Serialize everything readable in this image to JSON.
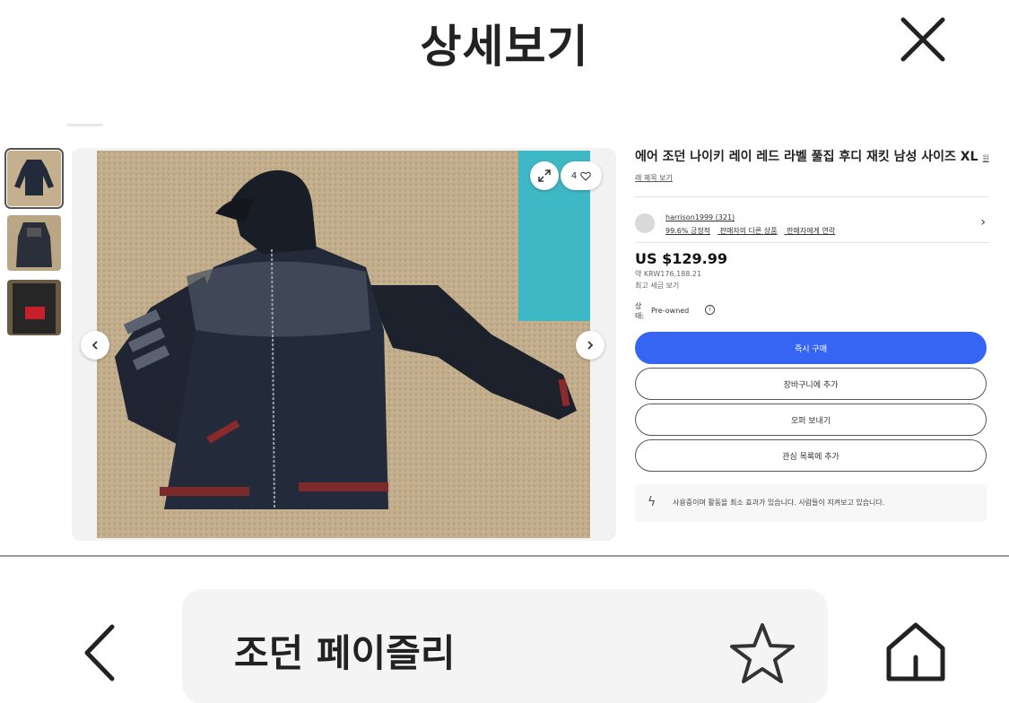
{
  "header": {
    "title": "상세보기"
  },
  "listing": {
    "title": "에어 조던 나이키 레이 레드 라벨 풀집 후디 재킷 남성 사이즈 XL",
    "title_sub": "원래 제목 보기",
    "favorite_count": "4",
    "seller": {
      "name": "harrison1999 (321)",
      "links": [
        "99.6% 긍정적",
        "판매자의 다른 상품",
        "판매자에게 연락"
      ]
    },
    "price": "US $129.99",
    "price_approx": "약 KRW176,188.21",
    "price_link": "최고 세금 보기",
    "condition_label": "상태:",
    "condition_value": "Pre-owned",
    "buttons": {
      "buy_now": "즉시 구매",
      "add_to_cart": "장바구니에 추가",
      "watch": "오퍼 보내기",
      "add_to_watchlist": "관심 목록에 추가"
    },
    "notice": "사용중이며 활동을 최소 효과가 있습니다. 사람들이 지켜보고 있습니다."
  },
  "bottom_bar": {
    "search_query": "조던 페이즐리"
  },
  "colors": {
    "accent": "#3665f3",
    "jacket": "#1f2533",
    "jacket_stripe": "#8a2a2a",
    "carpet": "#c2ad8c"
  }
}
